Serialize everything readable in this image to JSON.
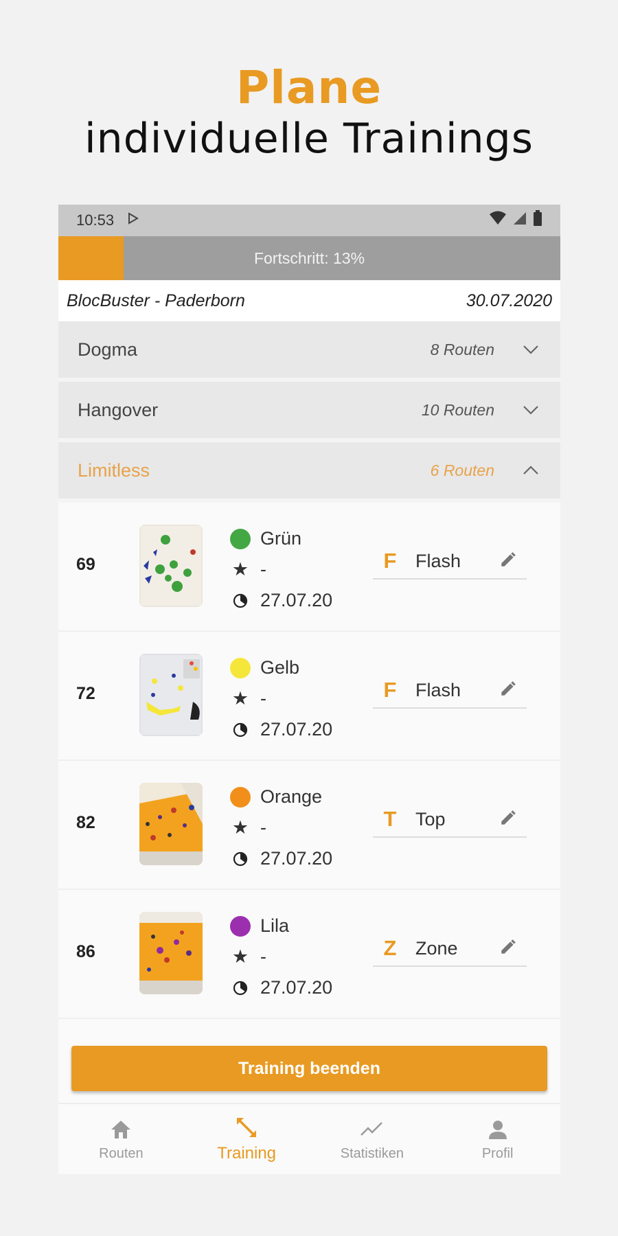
{
  "headline": {
    "accent": "Plane",
    "sub": "individuelle Trainings"
  },
  "status_bar": {
    "time": "10:53"
  },
  "progress": {
    "label": "Fortschritt: 13%",
    "fraction": 0.13,
    "color": "#e89a22"
  },
  "gym": {
    "name": "BlocBuster - Paderborn",
    "date": "30.07.2020"
  },
  "groups": [
    {
      "name": "Dogma",
      "count": "8 Routen",
      "expanded": false,
      "icon": "chevron-down-icon"
    },
    {
      "name": "Hangover",
      "count": "10 Routen",
      "expanded": false,
      "icon": "chevron-down-icon"
    },
    {
      "name": "Limitless",
      "count": "6 Routen",
      "expanded": true,
      "icon": "chevron-up-icon"
    }
  ],
  "routes": [
    {
      "number": "69",
      "color_name": "Grün",
      "color": "#43a843",
      "rating": "-",
      "date": "27.07.20",
      "result_letter": "F",
      "result_label": "Flash"
    },
    {
      "number": "72",
      "color_name": "Gelb",
      "color": "#f5e63a",
      "rating": "-",
      "date": "27.07.20",
      "result_letter": "F",
      "result_label": "Flash"
    },
    {
      "number": "82",
      "color_name": "Orange",
      "color": "#f28f1a",
      "rating": "-",
      "date": "27.07.20",
      "result_letter": "T",
      "result_label": "Top"
    },
    {
      "number": "86",
      "color_name": "Lila",
      "color": "#9b2fae",
      "rating": "-",
      "date": "27.07.20",
      "result_letter": "Z",
      "result_label": "Zone"
    }
  ],
  "cta": {
    "label": "Training beenden"
  },
  "nav": [
    {
      "label": "Routen",
      "icon": "home-icon",
      "active": false
    },
    {
      "label": "Training",
      "icon": "training-icon",
      "active": true
    },
    {
      "label": "Statistiken",
      "icon": "chart-icon",
      "active": false
    },
    {
      "label": "Profil",
      "icon": "person-icon",
      "active": false
    }
  ],
  "colors": {
    "accent": "#e89a22",
    "progress_track": "#9e9e9e",
    "group_bg": "#e8e8e8"
  }
}
